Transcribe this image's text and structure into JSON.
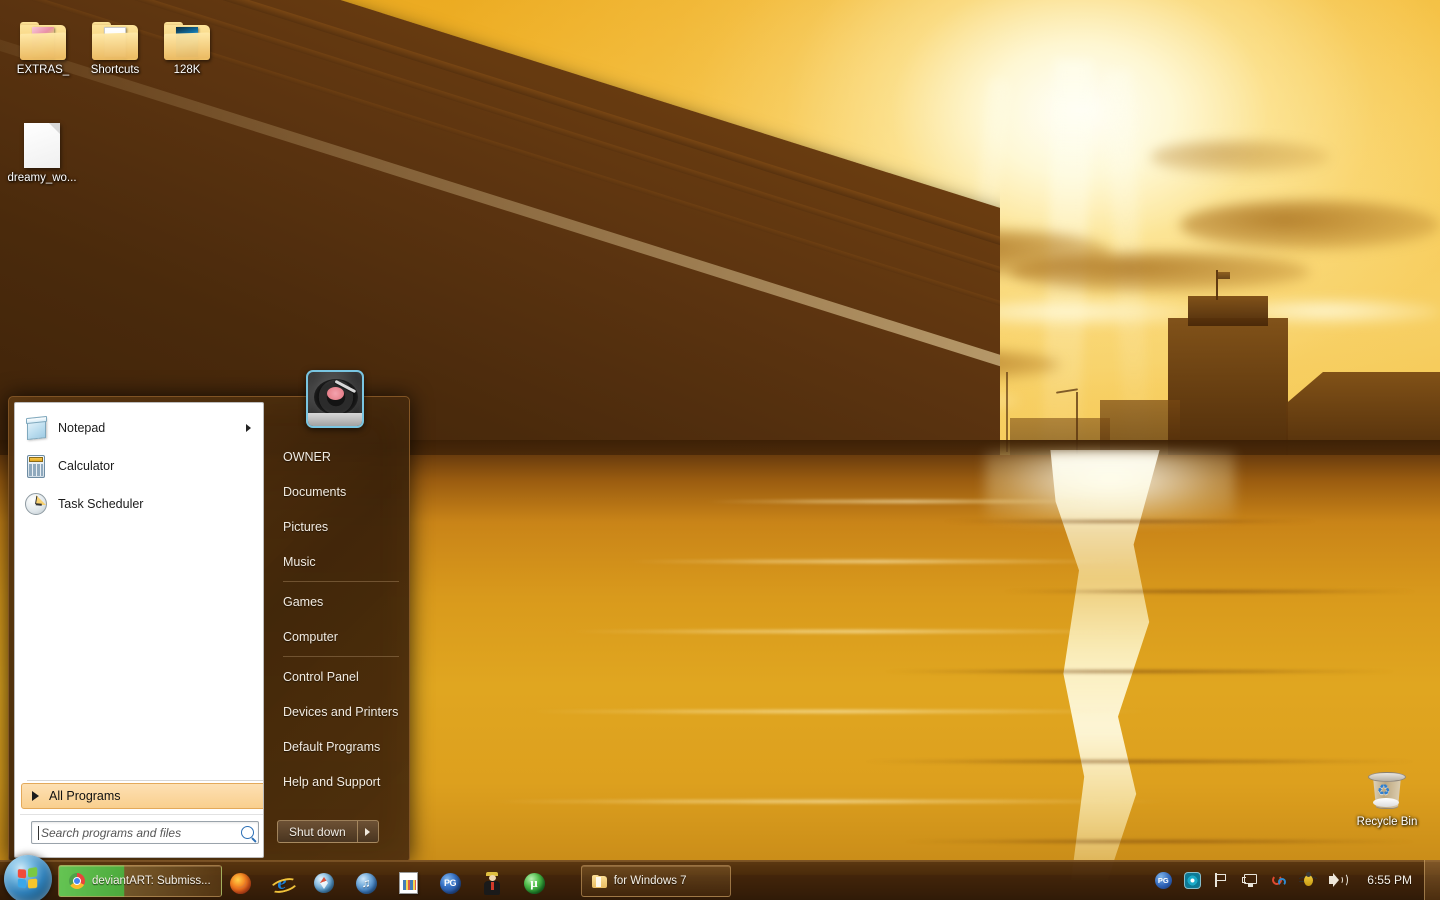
{
  "desktop": {
    "icons": [
      {
        "label": "EXTRAS_",
        "type": "folder",
        "preview": "photo"
      },
      {
        "label": "Shortcuts",
        "type": "folder",
        "preview": "papers"
      },
      {
        "label": "128K",
        "type": "folder",
        "preview": "abstract"
      },
      {
        "label": "dreamy_wo...",
        "type": "document",
        "preview": "blank"
      }
    ],
    "recycle_bin_label": "Recycle Bin",
    "wallpaper_description": "Golden sunset over a river with a concrete bridge silhouette, street lamps, city buildings and a bright sun reflection on the water"
  },
  "start_menu": {
    "user_name": "OWNER",
    "avatar_icon": "turntable-record-player",
    "programs": [
      {
        "label": "Notepad",
        "icon": "notepad-icon",
        "has_submenu": true
      },
      {
        "label": "Calculator",
        "icon": "calculator-icon",
        "has_submenu": false
      },
      {
        "label": "Task Scheduler",
        "icon": "clock-icon",
        "has_submenu": false
      }
    ],
    "all_programs_label": "All Programs",
    "search_placeholder": "Search programs and files",
    "search_value": "",
    "right_items": [
      {
        "label": "OWNER",
        "separator_after": false
      },
      {
        "label": "Documents",
        "separator_after": false
      },
      {
        "label": "Pictures",
        "separator_after": false
      },
      {
        "label": "Music",
        "separator_after": true
      },
      {
        "label": "Games",
        "separator_after": false
      },
      {
        "label": "Computer",
        "separator_after": true
      },
      {
        "label": "Control Panel",
        "separator_after": false
      },
      {
        "label": "Devices and Printers",
        "separator_after": false
      },
      {
        "label": "Default Programs",
        "separator_after": false
      },
      {
        "label": "Help and Support",
        "separator_after": false
      }
    ],
    "shutdown_label": "Shut down",
    "shutdown_arrow_icon": "chevron-right-icon"
  },
  "taskbar": {
    "start_orb_icon": "windows-logo-orb",
    "window_buttons": [
      {
        "label": "deviantART: Submiss...",
        "icon": "chrome-icon",
        "active": true
      },
      {
        "label": "for Windows 7",
        "icon": "folder-icon",
        "active": false
      }
    ],
    "quick_launch": [
      {
        "icon": "firefox-icon",
        "name": "Mozilla Firefox"
      },
      {
        "icon": "internet-explorer-icon",
        "name": "Internet Explorer"
      },
      {
        "icon": "globe-compass-icon",
        "name": "Browser"
      },
      {
        "icon": "itunes-icon",
        "name": "iTunes"
      },
      {
        "icon": "document-viewer-icon",
        "name": "Document"
      },
      {
        "icon": "pg-circle-icon",
        "name": "PG"
      },
      {
        "icon": "person-icon",
        "name": "Person"
      },
      {
        "icon": "utorrent-icon",
        "name": "uTorrent"
      }
    ],
    "tray_icons": [
      {
        "icon": "pg-circle-icon",
        "name": "PG"
      },
      {
        "icon": "eye-icon",
        "name": "Eye"
      },
      {
        "icon": "flag-action-center-icon",
        "name": "Action Center"
      },
      {
        "icon": "network-icon",
        "name": "Network"
      },
      {
        "icon": "sync-icon",
        "name": "Sync"
      },
      {
        "icon": "bug-icon",
        "name": "Bug"
      },
      {
        "icon": "volume-icon",
        "name": "Volume"
      }
    ],
    "clock": "6:55 PM",
    "show_desktop_label": ""
  },
  "colors": {
    "taskbar_brown": "#54320f",
    "start_menu_brown": "#3a2109",
    "accent_orange": "#f9cf8e",
    "sky_gold": "#f2b930",
    "water_gold": "#e0a620",
    "highlight_green": "#68d25a",
    "avatar_border_cyan": "#7dcdeb"
  }
}
